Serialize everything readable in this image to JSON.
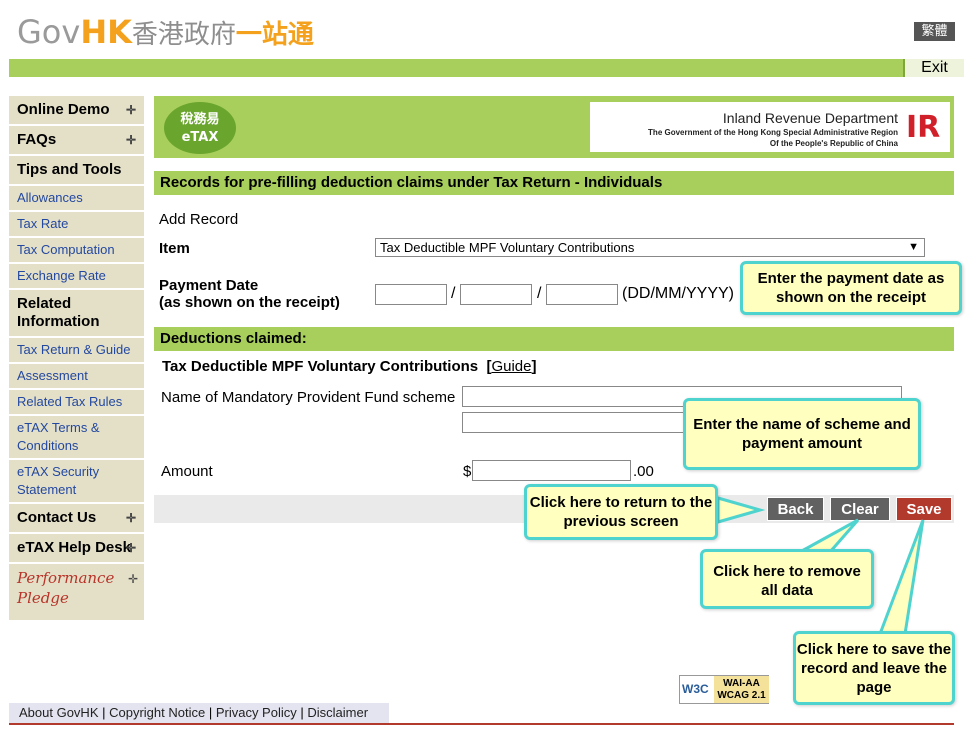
{
  "header": {
    "logo_gov": "Gov",
    "logo_hk": "HK",
    "logo_zh": "香港政府",
    "logo_zh2": "一站通",
    "lang_label": "繁體",
    "exit_label": "Exit"
  },
  "sidebar": {
    "items": [
      {
        "label": "Online Demo",
        "type": "head"
      },
      {
        "label": "FAQs",
        "type": "head"
      },
      {
        "label": "Tips and Tools",
        "type": "head"
      },
      {
        "label": "Allowances",
        "type": "link"
      },
      {
        "label": "Tax Rate",
        "type": "link"
      },
      {
        "label": "Tax Computation",
        "type": "link"
      },
      {
        "label": "Exchange Rate",
        "type": "link"
      },
      {
        "label": "Related Information",
        "type": "head"
      },
      {
        "label": "Tax Return & Guide",
        "type": "link"
      },
      {
        "label": "Assessment",
        "type": "link"
      },
      {
        "label": "Related Tax Rules",
        "type": "link"
      },
      {
        "label": "eTAX Terms & Conditions",
        "type": "link"
      },
      {
        "label": "eTAX Security Statement",
        "type": "link"
      },
      {
        "label": "Contact Us",
        "type": "head"
      },
      {
        "label": "eTAX Help Desk",
        "type": "head"
      }
    ],
    "pledge": "Performance Pledge"
  },
  "banner": {
    "etax_zh": "稅務易",
    "etax_en": "eTAX",
    "ird_name": "Inland Revenue Department",
    "ird_sub1": "The Government of the Hong Kong Special Administrative Region",
    "ird_sub2": "Of the People's Republic of China",
    "ird_mark": "IR"
  },
  "form": {
    "section_title": "Records for pre-filling deduction claims under Tax Return - Individuals",
    "add_record": "Add Record",
    "item_label": "Item",
    "item_value": "Tax Deductible MPF Voluntary Contributions",
    "payment_date_label": "Payment Date",
    "payment_date_sub": "(as shown on the receipt)",
    "date_sep": "/",
    "date_format": "(DD/MM/YYYY)",
    "deductions_title": "Deductions claimed:",
    "mpf_title": "Tax Deductible MPF Voluntary Contributions",
    "guide_link": "Guide",
    "scheme_label": "Name of Mandatory Provident Fund scheme",
    "amount_label": "Amount",
    "currency": "$",
    "cents": ".00"
  },
  "actions": {
    "back": "Back",
    "clear": "Clear",
    "save": "Save"
  },
  "callouts": {
    "payment_date": "Enter the payment date as shown on the receipt",
    "scheme": "Enter the name of scheme and payment amount",
    "back": "Click here to return to the previous screen",
    "clear": "Click here to remove all data",
    "save": "Click here to save the record and leave the page"
  },
  "footer": {
    "links": [
      "About GovHK",
      "Copyright Notice",
      "Privacy Policy",
      "Disclaimer"
    ],
    "badge_w3c": "W3C",
    "badge_level": "WAI-AA",
    "badge_ver": "WCAG 2.1"
  },
  "colors": {
    "accent_green": "#a8cf5b",
    "sidebar_bg": "#e4e0c8",
    "callout_bg": "#ffffbf",
    "callout_border": "#4fd3cf",
    "save_red": "#b23a2c",
    "button_grey": "#616161"
  }
}
